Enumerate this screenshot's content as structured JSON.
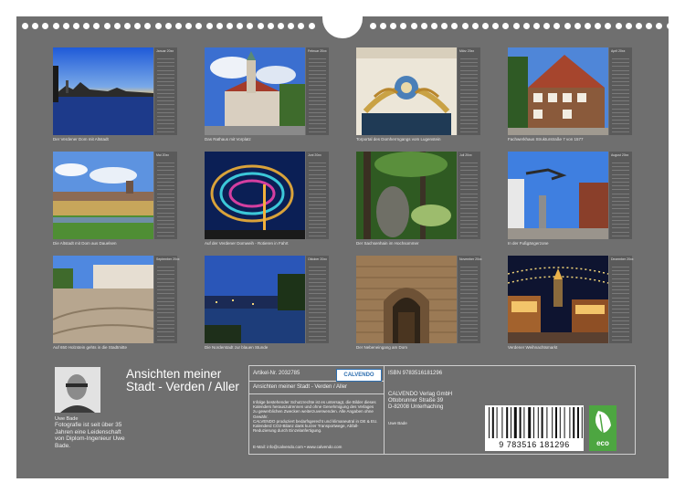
{
  "back_title": "Ansichten meiner Stadt - Verden / Aller",
  "author": {
    "name": "Uwe Bade",
    "bio": "Fotografie ist seit über 35 Jahren eine Leidenschaft von Diplom-Ingenieur Uwe Bade."
  },
  "months": [
    {
      "mini_title": "Januar 20xx",
      "caption": "Der Verdener Dom mit Altstadt"
    },
    {
      "mini_title": "Februar 20xx",
      "caption": "Das Rathaus mit Vorplatz"
    },
    {
      "mini_title": "März 20xx",
      "caption": "Torportal des Domherrngangs vom Lugenstein"
    },
    {
      "mini_title": "April 20xx",
      "caption": "Fachwerkhaus Strukturstraße 7 von 1577"
    },
    {
      "mini_title": "Mai 20xx",
      "caption": "Die Altstadt mit Dom aus Dauelsen"
    },
    {
      "mini_title": "Juni 20xx",
      "caption": "Auf der Verdener Domweih - Rotieren in Fahrt"
    },
    {
      "mini_title": "Juli 20xx",
      "caption": "Der Sachsenhain im Hochsommer"
    },
    {
      "mini_title": "August 20xx",
      "caption": "In der Fußgängerzone"
    },
    {
      "mini_title": "September 20xx",
      "caption": "Auf 650 Holzstein gehts in die Stadtmitte"
    },
    {
      "mini_title": "Oktober 20xx",
      "caption": "Die Norderstadt zur blauen Stunde"
    },
    {
      "mini_title": "November 20xx",
      "caption": "Der Nebeneingang am Dom"
    },
    {
      "mini_title": "Dezember 20xx",
      "caption": "Verdener Weihnachtsmarkt"
    }
  ],
  "info": {
    "article_no": "Artikel-Nr. 2032785",
    "calvendo_logo": "CALVENDO",
    "product_title": "Ansichten meiner Stadt - Verden / Aller",
    "legal_text_1": "Infolge bestehender Schutzrechte ist es untersagt, die Bilder dieses Kalenders herauszutrennen und ohne Genehmigung des Verlages zu gewerblichen Zwecken weiterzuverwenden. Alle Angaben ohne Gewähr.",
    "legal_text_2": "CALVENDO produziert bedarfsgerecht und klimaneutral in DE & EU. Kalenderd CO2-Bilanz dank kurzer Transportwege, Abfall-Reduzierung durch Einzelanfertigung.",
    "contact": "E-Mail: info@calvendo.com • www.calvendo.com",
    "isbn": "ISBN 9783516181296",
    "publisher": [
      "CALVENDO Verlag GmbH",
      "Ottobrunner Straße 39",
      "D-82008 Unterhaching"
    ],
    "publisher_small": "Uwe Bade",
    "barcode_digits": "9  783516  181296",
    "eco_label": "eco"
  }
}
